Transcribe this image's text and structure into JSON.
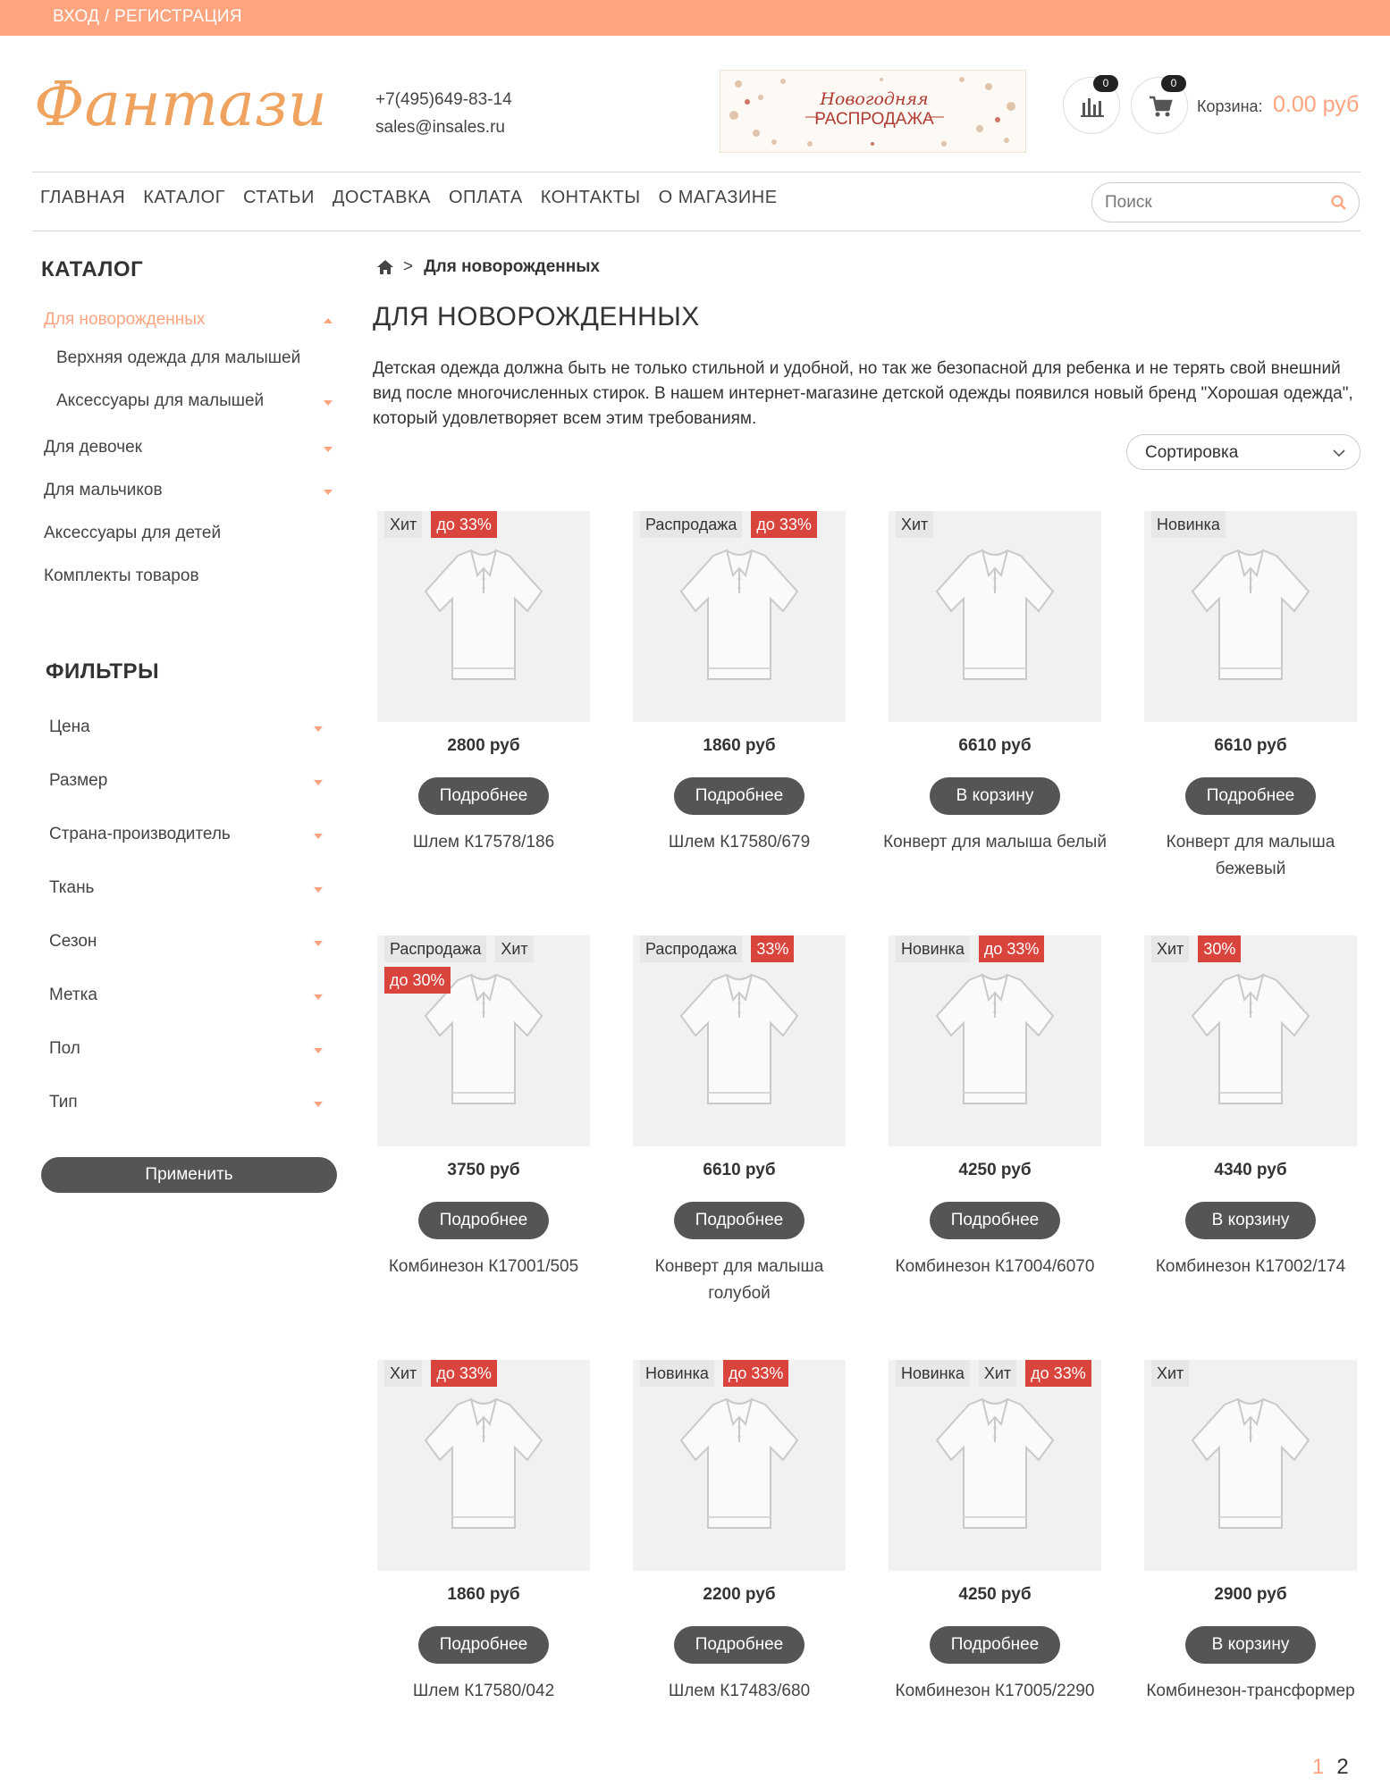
{
  "topbar": {
    "login_label": "ВХОД / РЕГИСТРАЦИЯ"
  },
  "header": {
    "logo_text": "Фантазия",
    "phone": "+7(495)649-83-14",
    "email": "sales@insales.ru",
    "banner_line1": "Новогодняя",
    "banner_line2": "РАСПРОДАЖА",
    "compare_count": "0",
    "cart_count": "0",
    "cart_label": "Корзина:",
    "cart_total": "0.00 руб"
  },
  "nav": [
    "ГЛАВНАЯ",
    "КАТАЛОГ",
    "СТАТЬИ",
    "ДОСТАВКА",
    "ОПЛАТА",
    "КОНТАКТЫ",
    "О МАГАЗИНЕ"
  ],
  "search": {
    "placeholder": "Поиск"
  },
  "catalog": {
    "title": "КАТАЛОГ",
    "items": [
      {
        "label": "Для новорожденных",
        "active": true
      },
      {
        "label": "Верхняя одежда для малышей"
      },
      {
        "label": "Аксессуары для малышей"
      },
      {
        "label": "Для девочек"
      },
      {
        "label": "Для мальчиков"
      },
      {
        "label": "Аксессуары для детей"
      },
      {
        "label": "Комплекты товаров"
      }
    ]
  },
  "filters": {
    "title": "ФИЛЬТРЫ",
    "items": [
      "Цена",
      "Размер",
      "Страна-производитель",
      "Ткань",
      "Сезон",
      "Метка",
      "Пол",
      "Тип"
    ],
    "apply_label": "Применить"
  },
  "breadcrumb": {
    "separator": ">",
    "current": "Для новорожденных"
  },
  "page": {
    "title": "ДЛЯ НОВОРОЖДЕННЫХ",
    "description": "Детская одежда должна быть не только стильной и удобной, но так же безопасной для ребенка и не терять свой внешний вид после многочисленных стирок. В нашем интернет-магазине детской одежды появился новый бренд \"Хорошая одежда\", который удовлетворяет всем этим требованиям.",
    "sort_label": "Сортировка"
  },
  "products": [
    {
      "labels": [
        "Хит"
      ],
      "discount": "до 33%",
      "price": "2800 руб",
      "button": "Подробнее",
      "name": "Шлем К17578/186"
    },
    {
      "labels": [
        "Распродажа"
      ],
      "discount": "до 33%",
      "price": "1860 руб",
      "button": "Подробнее",
      "name": "Шлем К17580/679"
    },
    {
      "labels": [
        "Хит"
      ],
      "discount": "",
      "price": "6610 руб",
      "button": "В корзину",
      "name": "Конверт для малыша белый"
    },
    {
      "labels": [
        "Новинка"
      ],
      "discount": "",
      "price": "6610 руб",
      "button": "Подробнее",
      "name": "Конверт для малыша бежевый"
    },
    {
      "labels": [
        "Распродажа",
        "Хит"
      ],
      "discount": "до 30%",
      "price": "3750 руб",
      "button": "Подробнее",
      "name": "Комбинезон К17001/505"
    },
    {
      "labels": [
        "Распродажа"
      ],
      "discount": "33%",
      "price": "6610 руб",
      "button": "Подробнее",
      "name": "Конверт для малыша голубой"
    },
    {
      "labels": [
        "Новинка"
      ],
      "discount": "до 33%",
      "price": "4250 руб",
      "button": "Подробнее",
      "name": "Комбинезон К17004/6070"
    },
    {
      "labels": [
        "Хит"
      ],
      "discount": "30%",
      "price": "4340 руб",
      "button": "В корзину",
      "name": "Комбинезон К17002/174"
    },
    {
      "labels": [
        "Хит"
      ],
      "discount": "до 33%",
      "price": "1860 руб",
      "button": "Подробнее",
      "name": "Шлем К17580/042"
    },
    {
      "labels": [
        "Новинка"
      ],
      "discount": "до 33%",
      "price": "2200 руб",
      "button": "Подробнее",
      "name": "Шлем К17483/680"
    },
    {
      "labels": [
        "Новинка",
        "Хит"
      ],
      "discount": "до 33%",
      "price": "4250 руб",
      "button": "Подробнее",
      "name": "Комбинезон К17005/2290"
    },
    {
      "labels": [
        "Хит"
      ],
      "discount": "",
      "price": "2900 руб",
      "button": "В корзину",
      "name": "Комбинезон-трансформер"
    }
  ],
  "pagination": {
    "current": "1",
    "next": "2"
  },
  "colors": {
    "accent": "#fea47f",
    "discount": "#d9443c",
    "button": "#555555"
  }
}
